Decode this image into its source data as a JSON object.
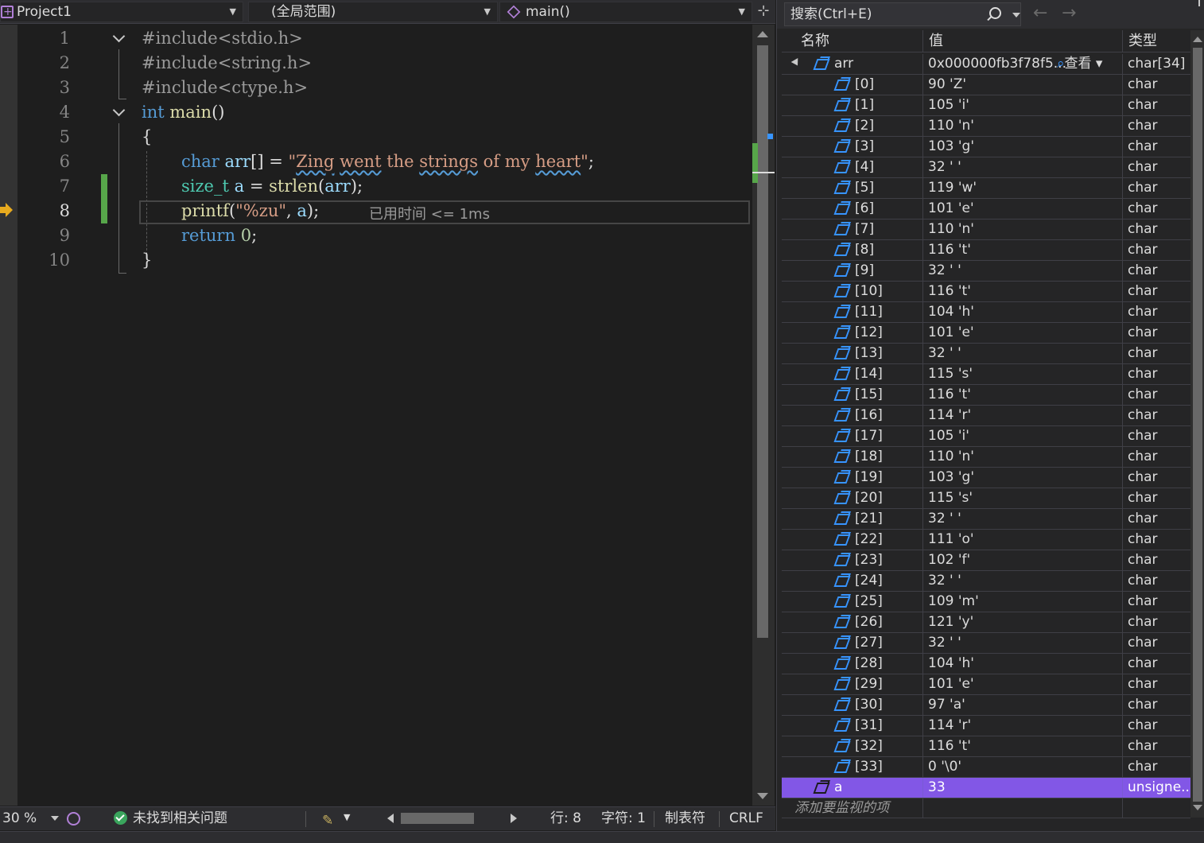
{
  "nav": {
    "project": "Project1",
    "scope": "(全局范围)",
    "function": "main()"
  },
  "editor": {
    "current_line": 8,
    "line_numbers": [
      "1",
      "2",
      "3",
      "4",
      "5",
      "6",
      "7",
      "8",
      "9",
      "10"
    ],
    "code": {
      "l1": "#include<stdio.h>",
      "l2": "#include<string.h>",
      "l3": "#include<ctype.h>",
      "l4_kw": "int",
      "l4_fn": "main",
      "l4_rest": "()",
      "l5": "{",
      "l6_kw": "char",
      "l6_var": "arr",
      "l6_mid": "[] = ",
      "l6_q1": "\"",
      "l6_w1": "Zing",
      "l6_sp1": " ",
      "l6_w2": "went",
      "l6_sp2": " the ",
      "l6_w3": "strings",
      "l6_sp3": " of my ",
      "l6_w4": "heart",
      "l6_q2": "\"",
      "l6_end": ";",
      "l7_type": "size_t",
      "l7_var": "a",
      "l7_mid": " = ",
      "l7_fn": "strlen",
      "l7_p1": "(",
      "l7_arg": "arr",
      "l7_end": ");",
      "l8_fn": "printf",
      "l8_p1": "(",
      "l8_str": "\"%zu\"",
      "l8_comma": ", ",
      "l8_arg": "a",
      "l8_end": ");",
      "l9_kw": "return",
      "l9_num": "0",
      "l9_end": ";",
      "l10": "}"
    },
    "perf_tip": "已用时间 <= 1ms"
  },
  "status": {
    "zoom": "30 %",
    "issues": "未找到相关问题",
    "line": "行: 8",
    "char": "字符: 1",
    "tabs": "制表符",
    "eol": "CRLF"
  },
  "watch": {
    "search_placeholder": "搜索(Ctrl+E)",
    "columns": {
      "name": "名称",
      "value": "值",
      "type": "类型"
    },
    "root": {
      "name": "arr",
      "value": "0x000000fb3f78f5...",
      "view": "查看",
      "type": "char[34]"
    },
    "items": [
      {
        "name": "[0]",
        "value": "90 'Z'",
        "type": "char"
      },
      {
        "name": "[1]",
        "value": "105 'i'",
        "type": "char"
      },
      {
        "name": "[2]",
        "value": "110 'n'",
        "type": "char"
      },
      {
        "name": "[3]",
        "value": "103 'g'",
        "type": "char"
      },
      {
        "name": "[4]",
        "value": "32 ' '",
        "type": "char"
      },
      {
        "name": "[5]",
        "value": "119 'w'",
        "type": "char"
      },
      {
        "name": "[6]",
        "value": "101 'e'",
        "type": "char"
      },
      {
        "name": "[7]",
        "value": "110 'n'",
        "type": "char"
      },
      {
        "name": "[8]",
        "value": "116 't'",
        "type": "char"
      },
      {
        "name": "[9]",
        "value": "32 ' '",
        "type": "char"
      },
      {
        "name": "[10]",
        "value": "116 't'",
        "type": "char"
      },
      {
        "name": "[11]",
        "value": "104 'h'",
        "type": "char"
      },
      {
        "name": "[12]",
        "value": "101 'e'",
        "type": "char"
      },
      {
        "name": "[13]",
        "value": "32 ' '",
        "type": "char"
      },
      {
        "name": "[14]",
        "value": "115 's'",
        "type": "char"
      },
      {
        "name": "[15]",
        "value": "116 't'",
        "type": "char"
      },
      {
        "name": "[16]",
        "value": "114 'r'",
        "type": "char"
      },
      {
        "name": "[17]",
        "value": "105 'i'",
        "type": "char"
      },
      {
        "name": "[18]",
        "value": "110 'n'",
        "type": "char"
      },
      {
        "name": "[19]",
        "value": "103 'g'",
        "type": "char"
      },
      {
        "name": "[20]",
        "value": "115 's'",
        "type": "char"
      },
      {
        "name": "[21]",
        "value": "32 ' '",
        "type": "char"
      },
      {
        "name": "[22]",
        "value": "111 'o'",
        "type": "char"
      },
      {
        "name": "[23]",
        "value": "102 'f'",
        "type": "char"
      },
      {
        "name": "[24]",
        "value": "32 ' '",
        "type": "char"
      },
      {
        "name": "[25]",
        "value": "109 'm'",
        "type": "char"
      },
      {
        "name": "[26]",
        "value": "121 'y'",
        "type": "char"
      },
      {
        "name": "[27]",
        "value": "32 ' '",
        "type": "char"
      },
      {
        "name": "[28]",
        "value": "104 'h'",
        "type": "char"
      },
      {
        "name": "[29]",
        "value": "101 'e'",
        "type": "char"
      },
      {
        "name": "[30]",
        "value": "97 'a'",
        "type": "char"
      },
      {
        "name": "[31]",
        "value": "114 'r'",
        "type": "char"
      },
      {
        "name": "[32]",
        "value": "116 't'",
        "type": "char"
      },
      {
        "name": "[33]",
        "value": "0 '\\0'",
        "type": "char"
      }
    ],
    "selected": {
      "name": "a",
      "value": "33",
      "type": "unsigne..."
    },
    "add_item": "添加要监视的项"
  }
}
